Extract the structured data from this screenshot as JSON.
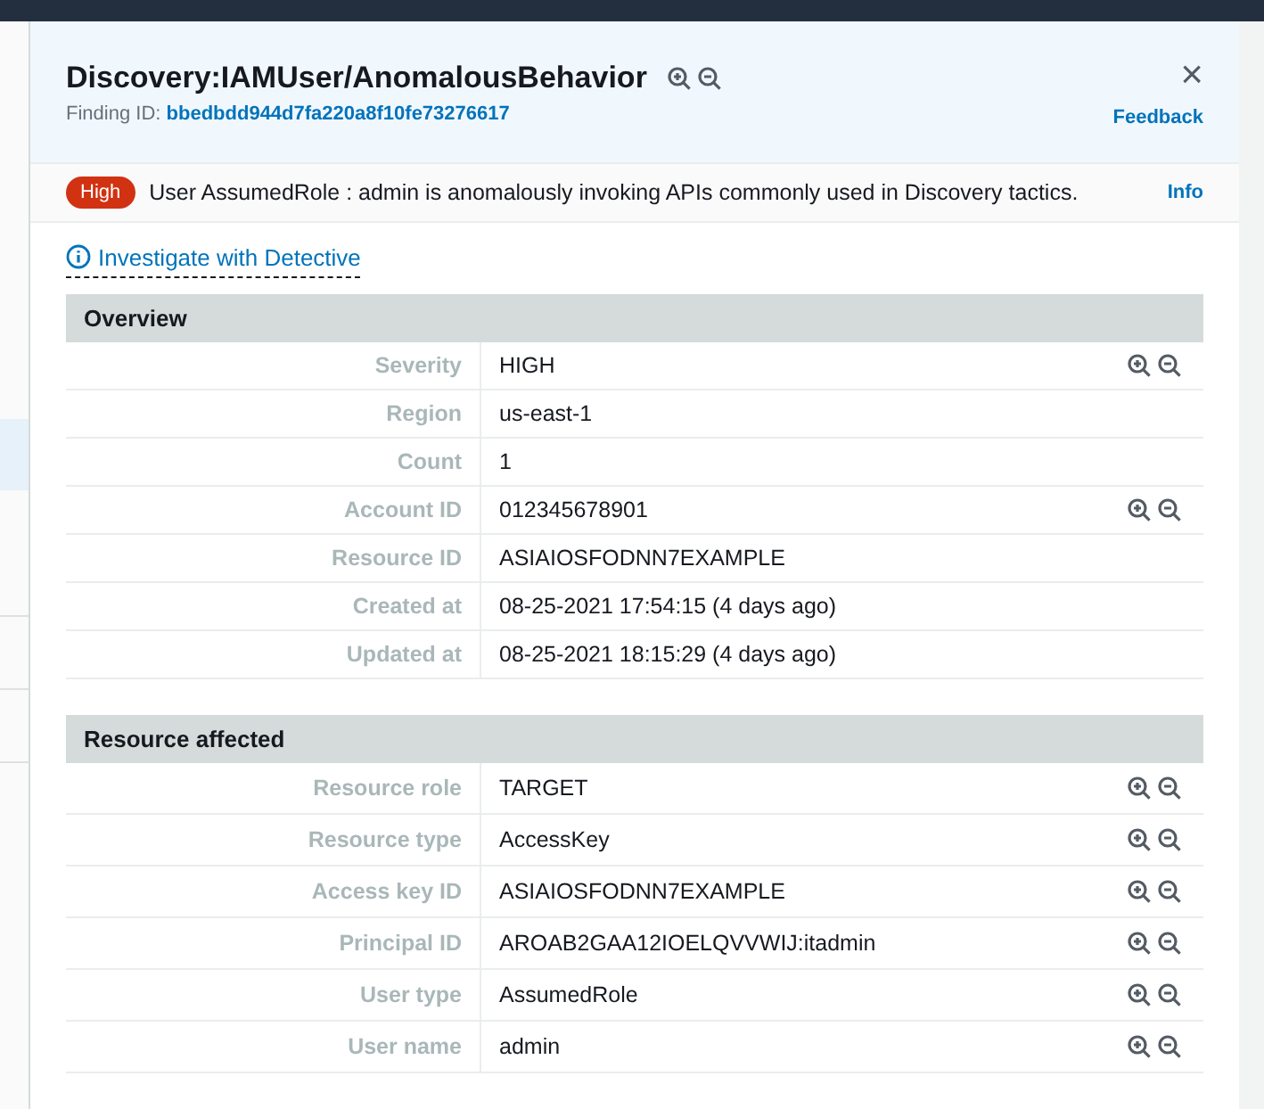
{
  "header": {
    "title": "Discovery:IAMUser/AnomalousBehavior",
    "finding_id_label": "Finding ID:",
    "finding_id": "bbedbdd944d7fa220a8f10fe73276617",
    "close": "×",
    "feedback": "Feedback"
  },
  "alert": {
    "severity": "High",
    "message": "User AssumedRole : admin is anomalously invoking APIs commonly used in Discovery tactics.",
    "info": "Info"
  },
  "investigate_link": "Investigate with Detective",
  "sections": [
    {
      "title": "Overview",
      "rows": [
        {
          "label": "Severity",
          "value": "HIGH",
          "filter": true
        },
        {
          "label": "Region",
          "value": "us-east-1",
          "filter": false
        },
        {
          "label": "Count",
          "value": "1",
          "filter": false
        },
        {
          "label": "Account ID",
          "value": "012345678901",
          "filter": true
        },
        {
          "label": "Resource ID",
          "value": "ASIAIOSFODNN7EXAMPLE",
          "filter": false
        },
        {
          "label": "Created at",
          "value": "08-25-2021 17:54:15 (4 days ago)",
          "filter": false
        },
        {
          "label": "Updated at",
          "value": "08-25-2021 18:15:29 (4 days ago)",
          "filter": false
        }
      ]
    },
    {
      "title": "Resource affected",
      "rows": [
        {
          "label": "Resource role",
          "value": "TARGET",
          "filter": true
        },
        {
          "label": "Resource type",
          "value": "AccessKey",
          "filter": true
        },
        {
          "label": "Access key ID",
          "value": "ASIAIOSFODNN7EXAMPLE",
          "filter": true
        },
        {
          "label": "Principal ID",
          "value": "AROAB2GAA12IOELQVVWIJ:itadmin",
          "filter": true
        },
        {
          "label": "User type",
          "value": "AssumedRole",
          "filter": true
        },
        {
          "label": "User name",
          "value": "admin",
          "filter": true
        }
      ]
    }
  ]
}
